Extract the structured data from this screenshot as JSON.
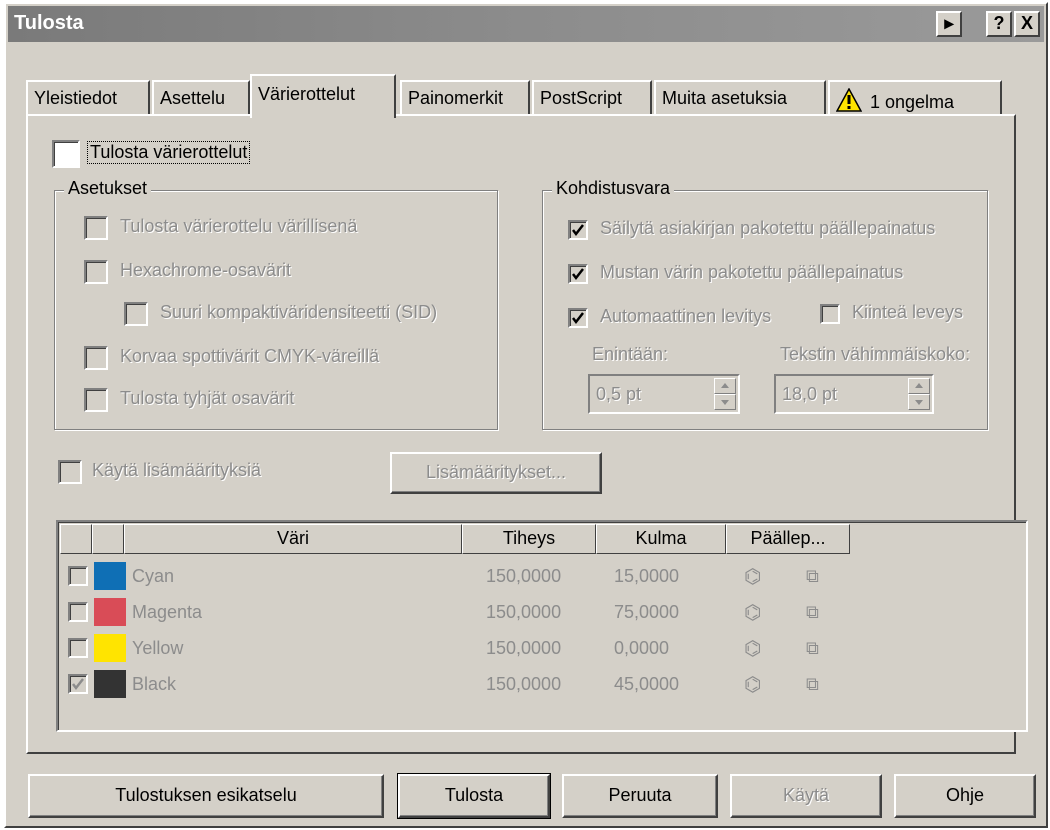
{
  "window": {
    "title": "Tulosta",
    "title_buttons": [
      "▸",
      "?",
      "X"
    ]
  },
  "tabs": [
    {
      "label": "Yleistiedot"
    },
    {
      "label": "Asettelu"
    },
    {
      "label": "Värierottelut",
      "active": true
    },
    {
      "label": "Painomerkit"
    },
    {
      "label": "PostScript"
    },
    {
      "label": "Muita asetuksia"
    },
    {
      "label": "1 ongelma",
      "icon": "warning-icon"
    }
  ],
  "main": {
    "print_separations": {
      "label": "Tulosta värierottelut",
      "checked": false
    },
    "settings_group": {
      "legend": "Asetukset",
      "options": [
        {
          "label": "Tulosta värierottelu värillisenä",
          "checked": false,
          "enabled": false
        },
        {
          "label": "Hexachrome-osavärit",
          "checked": false,
          "enabled": false
        },
        {
          "label": "Suuri kompaktiväridensiteetti (SID)",
          "checked": false,
          "enabled": false
        },
        {
          "label": "Korvaa spottivärit CMYK-väreillä",
          "checked": false,
          "enabled": false
        },
        {
          "label": "Tulosta tyhjät osavärit",
          "checked": false,
          "enabled": false
        }
      ]
    },
    "trap_group": {
      "legend": "Kohdistusvara",
      "options": [
        {
          "label": "Säilytä asiakirjan pakotettu päällepainatus",
          "checked": true
        },
        {
          "label": "Mustan värin pakotettu päällepainatus",
          "checked": true
        },
        {
          "label": "Automaattinen levitys",
          "checked": true
        },
        {
          "label": "Kiinteä leveys",
          "checked": false
        }
      ],
      "max_label": "Enintään:",
      "max_value": "0,5 pt",
      "text_min_label": "Tekstin vähimmäiskoko:",
      "text_min_value": "18,0 pt"
    },
    "advanced": {
      "checkbox_label": "Käytä lisämäärityksiä",
      "checked": false,
      "button_label": "Lisämääritykset..."
    },
    "table": {
      "columns": [
        "Väri",
        "Tiheys",
        "Kulma",
        "Päällep..."
      ],
      "rows": [
        {
          "checked": false,
          "color_hex": "#0f6fb5",
          "name": "Cyan",
          "density": "150,0000",
          "angle": "15,0000"
        },
        {
          "checked": false,
          "color_hex": "#d94c57",
          "name": "Magenta",
          "density": "150,0000",
          "angle": "75,0000"
        },
        {
          "checked": false,
          "color_hex": "#ffe400",
          "name": "Yellow",
          "density": "150,0000",
          "angle": "0,0000"
        },
        {
          "checked": true,
          "color_hex": "#333333",
          "name": "Black",
          "density": "150,0000",
          "angle": "45,0000"
        }
      ]
    }
  },
  "footer": {
    "preview": "Tulostuksen esikatselu",
    "print": "Tulosta",
    "cancel": "Peruuta",
    "apply": "Käytä",
    "help": "Ohje"
  }
}
